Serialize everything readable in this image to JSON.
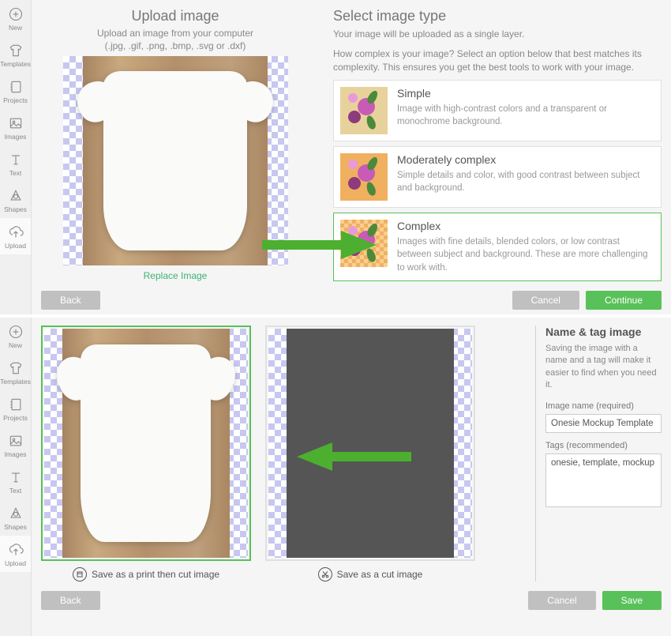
{
  "sidebar": {
    "items": [
      {
        "label": "New"
      },
      {
        "label": "Templates"
      },
      {
        "label": "Projects"
      },
      {
        "label": "Images"
      },
      {
        "label": "Text"
      },
      {
        "label": "Shapes"
      },
      {
        "label": "Upload"
      }
    ]
  },
  "top": {
    "upload_title": "Upload image",
    "upload_sub": "Upload an image from your computer",
    "upload_ext": "(.jpg, .gif, .png, .bmp, .svg or .dxf)",
    "replace": "Replace Image",
    "select_title": "Select image type",
    "select_sub1": "Your image will be uploaded as a single layer.",
    "select_sub2": "How complex is your image? Select an option below that best matches its complexity. This ensures you get the best tools to work with your image.",
    "options": [
      {
        "title": "Simple",
        "desc": "Image with high-contrast colors and a transparent or monochrome background."
      },
      {
        "title": "Moderately complex",
        "desc": "Simple details and color, with good contrast between subject and background."
      },
      {
        "title": "Complex",
        "desc": "Images with fine details, blended colors, or low contrast between subject and background. These are more challenging to work with."
      }
    ],
    "back": "Back",
    "cancel": "Cancel",
    "continue": "Continue"
  },
  "bottom": {
    "save_print_cut": "Save as a print then cut image",
    "save_cut": "Save as a cut image",
    "back": "Back",
    "cancel": "Cancel",
    "save": "Save",
    "name_tag_title": "Name & tag image",
    "name_tag_sub": "Saving the image with a name and a tag will make it easier to find when you need it.",
    "name_label": "Image name (required)",
    "name_value": "Onesie Mockup Template",
    "tags_label": "Tags (recommended)",
    "tags_value": "onesie, template, mockup"
  }
}
